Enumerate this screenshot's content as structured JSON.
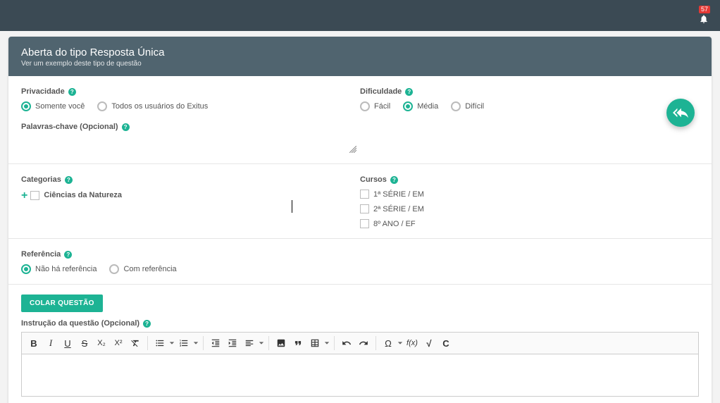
{
  "topbar": {
    "notification_count": "57"
  },
  "header": {
    "title": "Aberta do tipo Resposta Única",
    "subtitle": "Ver um exemplo deste tipo de questão"
  },
  "privacy": {
    "label": "Privacidade",
    "options": {
      "only_you": "Somente você",
      "all_users": "Todos os usuários do Exitus"
    },
    "selected": "only_you"
  },
  "difficulty": {
    "label": "Dificuldade",
    "options": {
      "easy": "Fácil",
      "medium": "Média",
      "hard": "Difícil"
    },
    "selected": "medium"
  },
  "keywords": {
    "label": "Palavras-chave (Opcional)"
  },
  "categories": {
    "label": "Categorias",
    "items": [
      {
        "label": "Ciências da Natureza",
        "checked": false
      }
    ]
  },
  "courses": {
    "label": "Cursos",
    "items": [
      {
        "label": "1ª SÉRIE / EM",
        "checked": false
      },
      {
        "label": "2ª SÉRIE / EM",
        "checked": false
      },
      {
        "label": "8º ANO / EF",
        "checked": false
      }
    ]
  },
  "reference": {
    "label": "Referência",
    "options": {
      "none": "Não há referência",
      "with": "Com referência"
    },
    "selected": "none"
  },
  "paste_button": "COLAR QUESTÃO",
  "instruction": {
    "label": "Instrução da questão (Opcional)"
  },
  "icons": {
    "help": "?",
    "bold_glyph": "B",
    "sub_glyph": "X₂",
    "sup_glyph": "X²",
    "omega_glyph": "Ω",
    "fx_glyph": "f(x)",
    "sqrt_glyph": "√",
    "c_glyph": "C"
  },
  "colors": {
    "accent": "#1db394",
    "topbar": "#3b4a54",
    "card_header": "#50646f",
    "badge": "#e53935"
  }
}
